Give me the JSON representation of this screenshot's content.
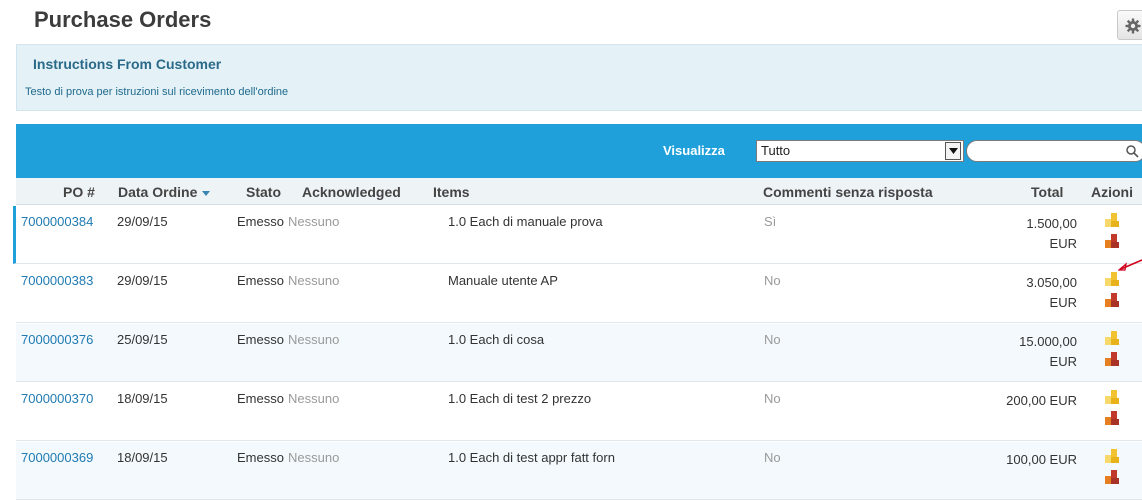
{
  "page": {
    "title": "Purchase Orders"
  },
  "instructions": {
    "title": "Instructions From Customer",
    "text": "Testo di prova per istruzioni sul ricevimento dell'ordine"
  },
  "toolbar": {
    "view_label": "Visualizza",
    "view_selected": "Tutto",
    "search_placeholder": ""
  },
  "table": {
    "columns": [
      "PO #",
      "Data Ordine",
      "Stato",
      "Acknowledged",
      "Items",
      "Commenti senza risposta",
      "Total",
      "Azioni"
    ],
    "rows": [
      {
        "po": "7000000384",
        "date": "29/09/15",
        "stato": "Emesso",
        "ack": "Nessuno",
        "items": "1.0 Each di manuale prova",
        "commenti": "Sì",
        "total_1": "1.500,00",
        "total_2": "EUR"
      },
      {
        "po": "7000000383",
        "date": "29/09/15",
        "stato": "Emesso",
        "ack": "Nessuno",
        "items": "Manuale utente AP",
        "commenti": "No",
        "total_1": "3.050,00",
        "total_2": "EUR"
      },
      {
        "po": "7000000376",
        "date": "25/09/15",
        "stato": "Emesso",
        "ack": "Nessuno",
        "items": "1.0 Each di cosa",
        "commenti": "No",
        "total_1": "15.000,00",
        "total_2": "EUR"
      },
      {
        "po": "7000000370",
        "date": "18/09/15",
        "stato": "Emesso",
        "ack": "Nessuno",
        "items": "1.0 Each di test 2 prezzo",
        "commenti": "No",
        "total_1": "200,00 EUR",
        "total_2": ""
      },
      {
        "po": "7000000369",
        "date": "18/09/15",
        "stato": "Emesso",
        "ack": "Nessuno",
        "items": "1.0 Each di test appr fatt forn",
        "commenti": "No",
        "total_1": "100,00 EUR",
        "total_2": ""
      }
    ]
  },
  "colors": {
    "accent": "#1fa0da",
    "link": "#1f7ab3",
    "instructions_bg": "#e4f1f7"
  },
  "icons": {
    "settings": "gear-icon",
    "search": "search-icon",
    "action_1": "create-invoice-icon",
    "action_2": "create-credit-icon"
  }
}
